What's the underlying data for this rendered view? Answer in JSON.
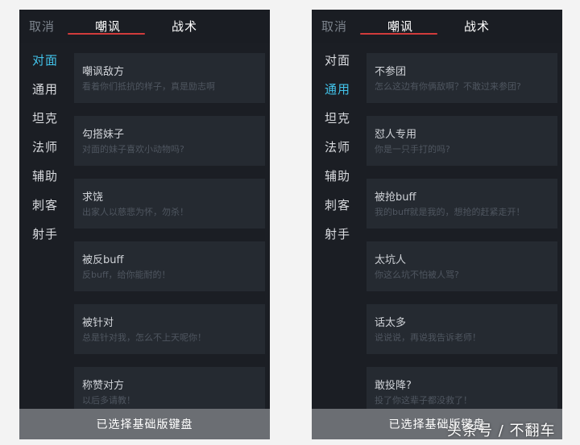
{
  "panels": [
    {
      "cancel": "取消",
      "tabs": [
        "嘲讽",
        "战术"
      ],
      "active_tab": "嘲讽",
      "sidebar": [
        "对面",
        "通用",
        "坦克",
        "法师",
        "辅助",
        "刺客",
        "射手"
      ],
      "active_sidebar": "对面",
      "items": [
        {
          "title": "嘲讽敌方",
          "subtitle": "看着你们抵抗的样子，真是励志啊"
        },
        {
          "title": "勾搭妹子",
          "subtitle": "对面的妹子喜欢小动物吗?"
        },
        {
          "title": "求饶",
          "subtitle": "出家人以慈悲为怀，勿杀！"
        },
        {
          "title": "被反buff",
          "subtitle": "反buff，给你能耐的！"
        },
        {
          "title": "被针对",
          "subtitle": "总是针对我，怎么不上天呢你！"
        },
        {
          "title": "称赞对方",
          "subtitle": "以后多请教！"
        }
      ],
      "bottom_text": "已选择基础版键盘"
    },
    {
      "cancel": "取消",
      "tabs": [
        "嘲讽",
        "战术"
      ],
      "active_tab": "嘲讽",
      "sidebar": [
        "对面",
        "通用",
        "坦克",
        "法师",
        "辅助",
        "刺客",
        "射手"
      ],
      "active_sidebar": "通用",
      "items": [
        {
          "title": "不参团",
          "subtitle": "怎么这边有你俩敌啊？不敢过来参团?"
        },
        {
          "title": "怼人专用",
          "subtitle": "你是一只手打的吗?"
        },
        {
          "title": "被抢buff",
          "subtitle": "我的buff就是我的，想抢的赶紧走开！"
        },
        {
          "title": "太坑人",
          "subtitle": "你这么坑不怕被人骂?"
        },
        {
          "title": "话太多",
          "subtitle": "说说说，再说我告诉老师！"
        },
        {
          "title": "敢投降?",
          "subtitle": "投了你这辈子都没救了！"
        }
      ],
      "bottom_text": "已选择基础版键盘"
    }
  ],
  "colors": {
    "active_sidebar": "#42c3ea",
    "tab_underline": "#d13b3b",
    "panel_bg": "#1b1e24",
    "card_bg": "#252a31",
    "bottom_bar": "#6b6e73"
  },
  "watermark": "头条号 / 不翻车"
}
